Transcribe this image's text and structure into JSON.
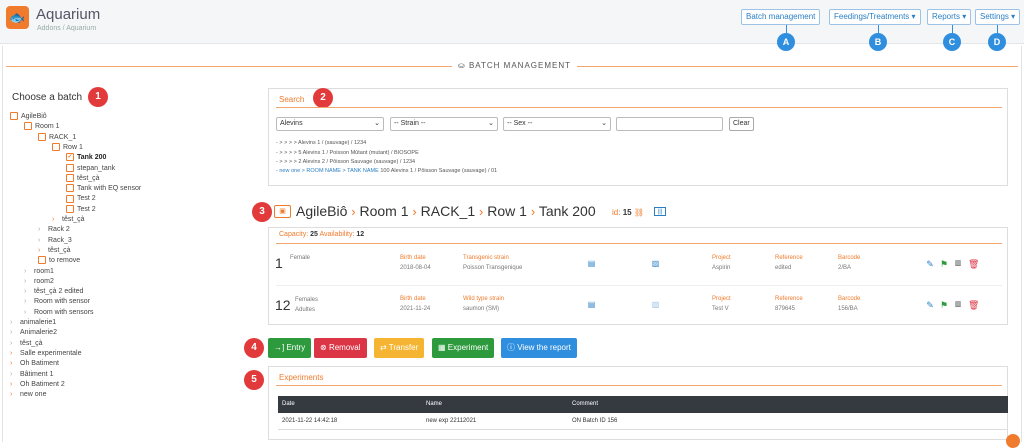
{
  "header": {
    "title": "Aquarium",
    "breadcrumb": "Addons / Aquarium",
    "menu": [
      {
        "label": "Batch management",
        "marker": "A"
      },
      {
        "label": "Feedings/Treatments",
        "marker": "B"
      },
      {
        "label": "Reports",
        "marker": "C"
      },
      {
        "label": "Settings",
        "marker": "D"
      }
    ]
  },
  "section_title": "BATCH MANAGEMENT",
  "choose_batch": {
    "title": "Choose a batch",
    "marker": "1"
  },
  "tree": [
    {
      "label": "AgileBiô",
      "open": true
    },
    {
      "label": "Room 1",
      "open": true
    },
    {
      "label": "RACK_1",
      "open": true
    },
    {
      "label": "Row 1",
      "open": true
    },
    {
      "label": "Tank 200",
      "checked": true
    },
    {
      "label": "stepan_tank"
    },
    {
      "label": "têst_çà"
    },
    {
      "label": "Tank with EQ sensor"
    },
    {
      "label": "Test 2"
    },
    {
      "label": "Test 2"
    },
    {
      "label": "têst_çà"
    },
    {
      "label": "Rack 2"
    },
    {
      "label": "Rack_3"
    },
    {
      "label": "têst_çà"
    },
    {
      "label": "to remove"
    },
    {
      "label": "room1"
    },
    {
      "label": "room2"
    },
    {
      "label": "têst_çà 2 edited"
    },
    {
      "label": "Room with sensor"
    },
    {
      "label": "Room with sensors"
    },
    {
      "label": "animalerie1"
    },
    {
      "label": "Animalerie2"
    },
    {
      "label": "têst_çà"
    },
    {
      "label": "Salle experimentale"
    },
    {
      "label": "Oh Batiment"
    },
    {
      "label": "Bâtiment 1"
    },
    {
      "label": "Oh Batiment 2"
    },
    {
      "label": "new one"
    }
  ],
  "search": {
    "title": "Search",
    "marker": "2",
    "strain_select": "Alevins",
    "strain_placeholder": "-- Strain --",
    "sex_placeholder": "-- Sex --",
    "input_value": "",
    "clear_label": "Clear",
    "results": [
      "- > > > >  Alevins 1 / (sauvage) / 1234",
      "- > > > >  5 Alevins 1 / Poisson Mûtant (mutant) / BIOSOPE",
      "- > > > >  2 Alevins 2 / Pôisson Sauvage (sauvage) / 1234"
    ],
    "result_link": "- new one > ROOM NAME > TANK NAME",
    "result_link_tail": "100 Alevins 1 / Pôisson Sauvage (sauvage) / 01"
  },
  "breadcrumb_path": {
    "marker": "3",
    "parts": [
      "AgileBiô",
      "Room 1",
      "RACK_1",
      "Row 1",
      "Tank 200"
    ],
    "id_label": "id:",
    "id_value": "15"
  },
  "tank": {
    "capacity_label": "Capacity:",
    "capacity": "25",
    "availability_label": "Availability:",
    "availability": "12",
    "rows": [
      {
        "count": "1",
        "sex": "Female",
        "sex2": "",
        "birth_label": "Birth date",
        "birth": "2018-08-04",
        "strain_label": "Transgenic strain",
        "strain": "Poisson Transgenique",
        "project_label": "Project",
        "project": "Aspirin",
        "ref_label": "Reference",
        "ref": "edited",
        "barcode_label": "Barcode",
        "barcode": "2/BA"
      },
      {
        "count": "12",
        "sex": "Females",
        "sex2": "Adultes",
        "birth_label": "Birth date",
        "birth": "2021-11-24",
        "strain_label": "Wild type strain",
        "strain": "saumon (SM)",
        "project_label": "Project",
        "project": "Test V",
        "ref_label": "Reference",
        "ref": "879645",
        "barcode_label": "Barcode",
        "barcode": "156/BA"
      }
    ]
  },
  "actions": {
    "marker": "4",
    "buttons": [
      {
        "label": "Entry",
        "icon": "→]",
        "color": "#2e9a3e"
      },
      {
        "label": "Removal",
        "icon": "⊗",
        "color": "#dc3545"
      },
      {
        "label": "Transfer",
        "icon": "⇄",
        "color": "#f5b532"
      },
      {
        "label": "Experiment",
        "icon": "▦",
        "color": "#2e9a3e"
      },
      {
        "label": "View the report",
        "icon": "ⓘ",
        "color": "#2f8ede"
      }
    ]
  },
  "experiments": {
    "marker": "5",
    "title": "Experiments",
    "headers": [
      "Date",
      "Name",
      "Comment"
    ],
    "rows": [
      {
        "date": "2021-11-22 14:42:18",
        "name": "new exp 22112021",
        "comment": "ON Batch ID 156"
      }
    ]
  }
}
